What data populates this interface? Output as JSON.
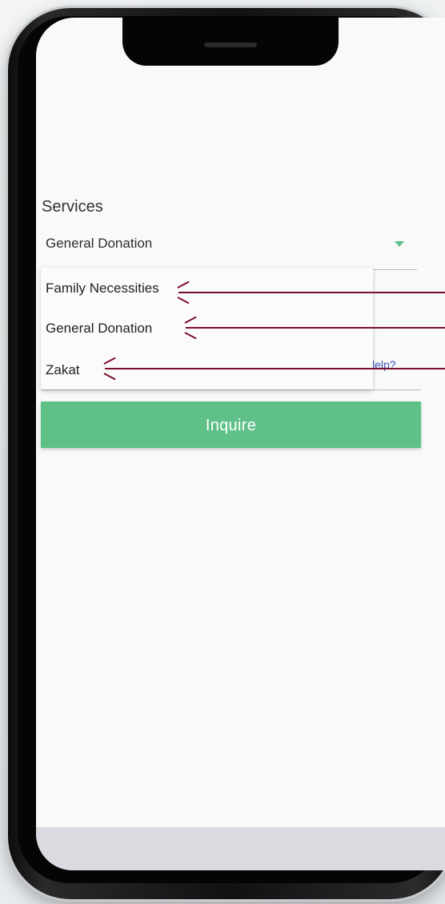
{
  "form": {
    "services_label": "Services",
    "selected_service": "General Donation",
    "hidden_help_text": "lelp?",
    "inquire_label": "Inquire"
  },
  "dropdown": {
    "options": [
      {
        "label": "Family Necessities"
      },
      {
        "label": "General Donation"
      },
      {
        "label": "Zakat"
      }
    ]
  },
  "colors": {
    "accent_green": "#5fc187",
    "caret_green": "#5bc18a",
    "arrow_color": "#7a0f2a",
    "link_blue": "#3f51b5"
  },
  "icons": {
    "dropdown_caret": "chevron-down-icon",
    "annotation_arrows": "arrow-left-icon"
  }
}
